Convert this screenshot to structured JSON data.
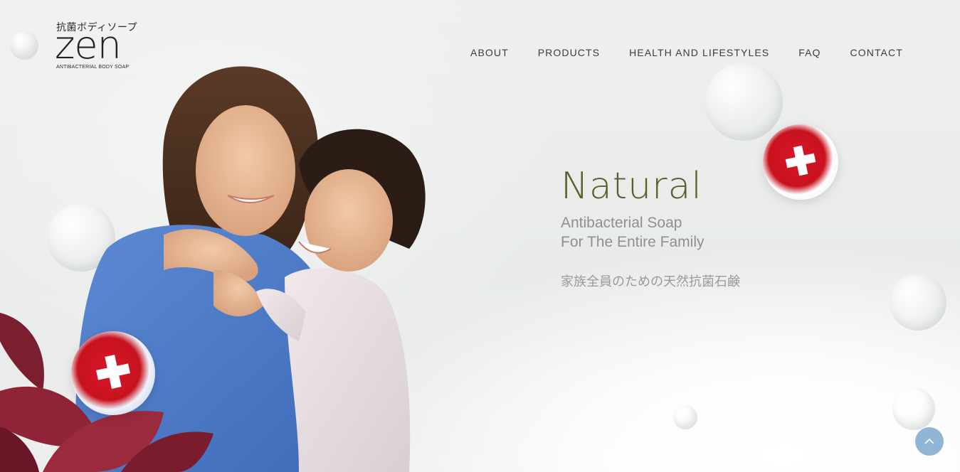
{
  "logo": {
    "jp_text": "抗菌ボディソープ",
    "wordmark": "zen",
    "subtitle": "ANTIBACTERIAL BODY SOAP"
  },
  "nav": {
    "items": [
      {
        "label": "ABOUT"
      },
      {
        "label": "PRODUCTS"
      },
      {
        "label": "HEALTH AND LIFESTYLES"
      },
      {
        "label": "FAQ"
      },
      {
        "label": "CONTACT"
      }
    ]
  },
  "hero": {
    "title": "Natural",
    "subtitle_line1": "Antibacterial Soap",
    "subtitle_line2": "For The Entire Family",
    "jp_tagline": "家族全員のための天然抗菌石鹸"
  },
  "colors": {
    "title": "#5d5f2a",
    "nav_text": "#3b3b3b",
    "subtitle_text": "#8f9090",
    "scroll_button": "#7fa9cf",
    "swiss_red": "#d8172a"
  },
  "icons": {
    "scroll_top": "chevron-up-icon",
    "badge": "swiss-cross-icon"
  }
}
